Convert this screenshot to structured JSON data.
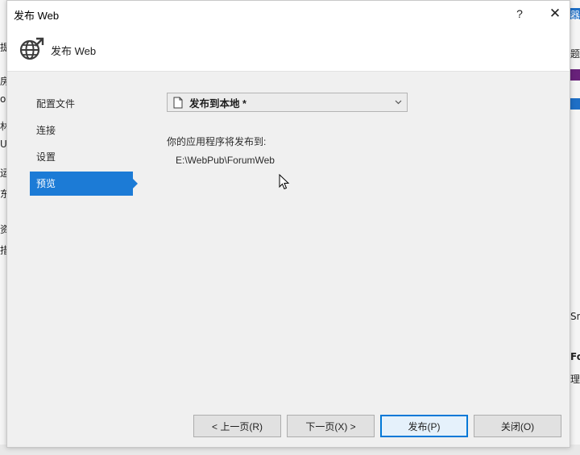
{
  "window": {
    "title": "发布 Web",
    "help_glyph": "?",
    "close_glyph": "✕"
  },
  "header": {
    "title": "发布 Web",
    "icon": "globe-publish-icon"
  },
  "nav": {
    "items": [
      {
        "label": "配置文件",
        "active": false
      },
      {
        "label": "连接",
        "active": false
      },
      {
        "label": "设置",
        "active": false
      },
      {
        "label": "预览",
        "active": true
      }
    ]
  },
  "profile": {
    "selected": "发布到本地 *",
    "icon": "document-icon"
  },
  "preview": {
    "publish_to_label": "你的应用程序将发布到:",
    "publish_path": "E:\\WebPub\\ForumWeb"
  },
  "buttons": {
    "prev": "< 上一页(R)",
    "next": "下一页(X) >",
    "publish": "发布(P)",
    "close": "关闭(O)"
  },
  "colors": {
    "accent": "#1c7bd6",
    "dialog_bg": "#f0f0f0",
    "header_bg": "#ffffff"
  },
  "background_fragments": {
    "left": [
      "提",
      "房",
      "or",
      "林",
      "UE",
      "运",
      "东",
      "资",
      "措"
    ],
    "right": [
      "器",
      "题",
      "Sn",
      "Fo",
      "理"
    ]
  }
}
